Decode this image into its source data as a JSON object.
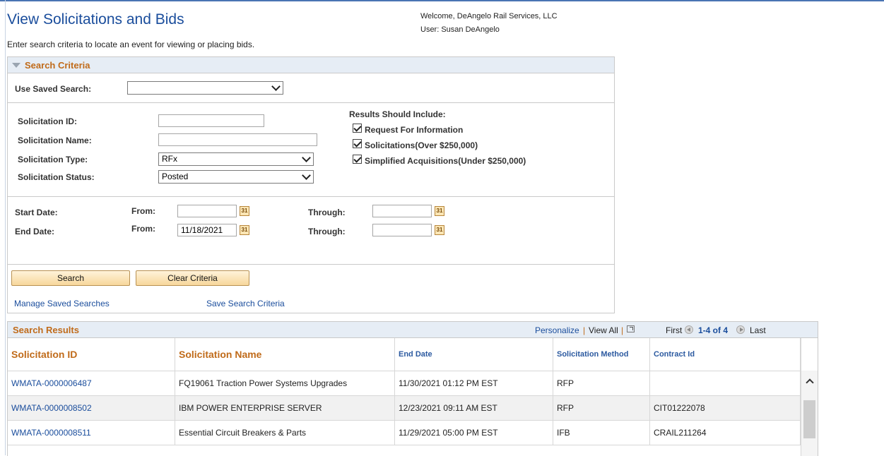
{
  "page": {
    "title": "View Solicitations and Bids",
    "welcome": "Welcome, DeAngelo Rail Services, LLC",
    "user": "User: Susan DeAngelo",
    "intro": "Enter search criteria to locate an event for viewing or placing bids."
  },
  "search_criteria": {
    "header": "Search Criteria",
    "saved_search_label": "Use Saved Search:",
    "saved_search_value": "",
    "solicitation_id_label": "Solicitation ID:",
    "solicitation_id_value": "",
    "solicitation_name_label": "Solicitation Name:",
    "solicitation_name_value": "",
    "solicitation_type_label": "Solicitation Type:",
    "solicitation_type_value": "RFx",
    "solicitation_status_label": "Solicitation Status:",
    "solicitation_status_value": "Posted",
    "results_include_label": "Results Should Include:",
    "checkboxes": [
      {
        "label": "Request For Information",
        "checked": true
      },
      {
        "label": "Solicitations(Over $250,000)",
        "checked": true
      },
      {
        "label": "Simplified Acquisitions(Under $250,000)",
        "checked": true
      }
    ],
    "start_date_label": "Start Date:",
    "end_date_label": "End Date:",
    "from_label": "From:",
    "through_label": "Through:",
    "start_from_value": "",
    "start_through_value": "",
    "end_from_value": "11/18/2021",
    "end_through_value": "",
    "search_button": "Search",
    "clear_button": "Clear Criteria",
    "manage_link": "Manage Saved Searches",
    "save_link": "Save Search Criteria"
  },
  "results": {
    "title": "Search Results",
    "personalize": "Personalize",
    "view_all": "View All",
    "sep": "|",
    "first": "First",
    "range": "1-4 of 4",
    "last": "Last",
    "columns": [
      "Solicitation ID",
      "Solicitation Name",
      "End Date",
      "Solicitation Method",
      "Contract Id"
    ],
    "rows": [
      {
        "id": "WMATA-0000006487",
        "name": "FQ19061 Traction Power Systems Upgrades",
        "end_date": "11/30/2021 01:12 PM EST",
        "method": "RFP",
        "contract": ""
      },
      {
        "id": "WMATA-0000008502",
        "name": "IBM POWER ENTERPRISE SERVER",
        "end_date": "12/23/2021 09:11 AM EST",
        "method": "RFP",
        "contract": "CIT01222078"
      },
      {
        "id": "WMATA-0000008511",
        "name": "Essential Circuit Breakers & Parts",
        "end_date": "11/29/2021 05:00 PM EST",
        "method": "IFB",
        "contract": "CRAIL211264"
      }
    ]
  },
  "colors": {
    "title_blue": "#1a4d9c",
    "section_orange": "#c06b1a",
    "header_band": "#e6edf5"
  }
}
